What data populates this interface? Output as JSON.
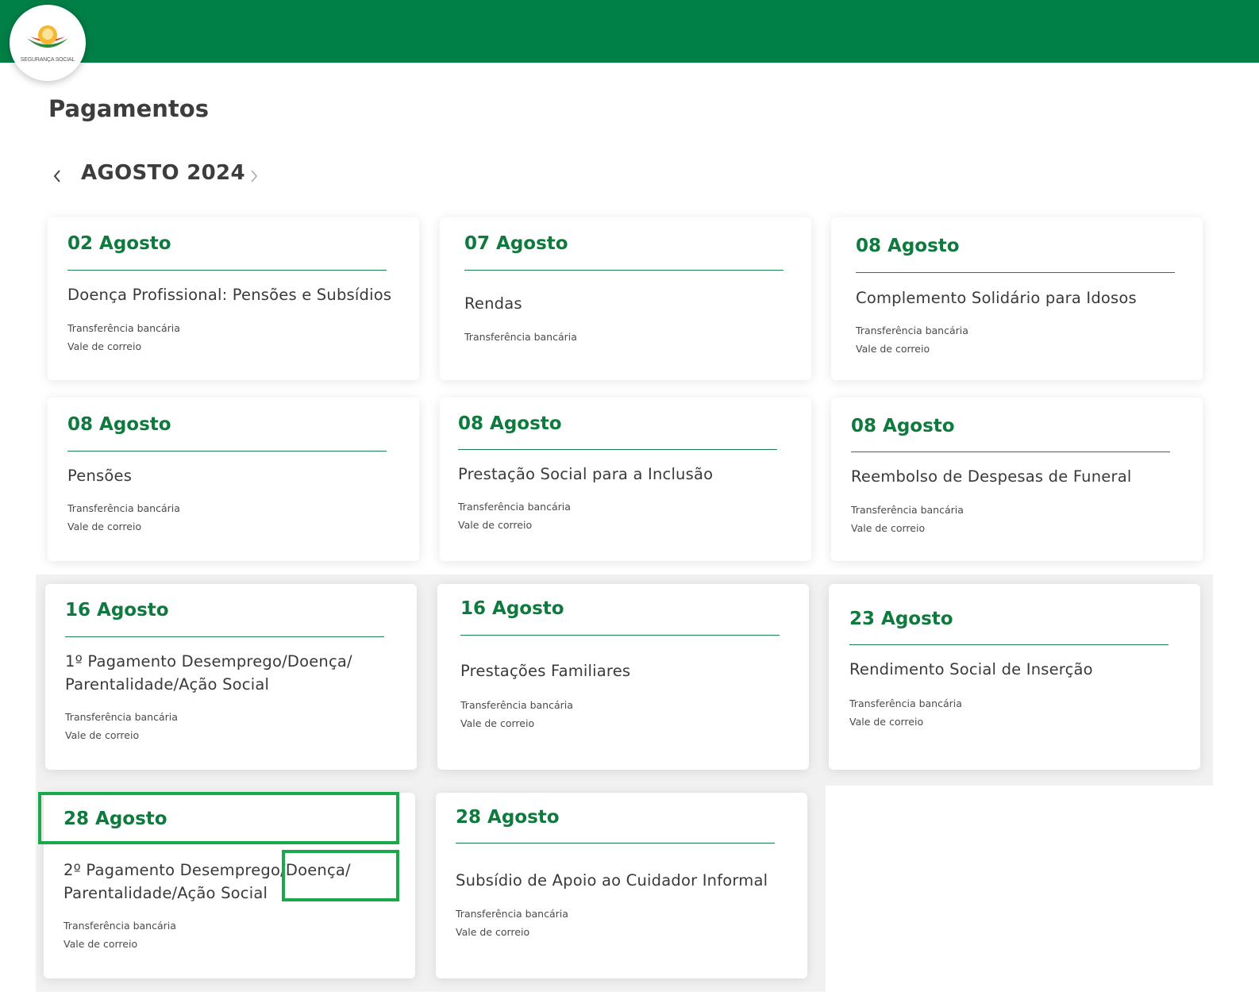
{
  "header": {
    "logo_text": "SEGURANÇA SOCIAL",
    "brand_color": "#007f46",
    "logo_icon": "seguranca-social-logo-icon"
  },
  "page": {
    "title": "Pagamentos"
  },
  "month_nav": {
    "label": "AGOSTO 2024",
    "prev_icon": "chevron-left-icon",
    "next_icon": "chevron-right-icon"
  },
  "accent_color": "#0f7a3e",
  "highlight_color": "#1aa84c",
  "cards": [
    {
      "date": "02 Agosto",
      "title": "Doença Profissional: Pensões e Subsídios",
      "methods": [
        "Transferência bancária",
        "Vale de correio"
      ]
    },
    {
      "date": "07 Agosto",
      "title": "Rendas",
      "methods": [
        "Transferência bancária"
      ]
    },
    {
      "date": "08 Agosto",
      "title": "Complemento Solidário para Idosos",
      "methods": [
        "Transferência bancária",
        "Vale de correio"
      ]
    },
    {
      "date": "08 Agosto",
      "title": "Pensões",
      "methods": [
        "Transferência bancária",
        "Vale de correio"
      ]
    },
    {
      "date": "08 Agosto",
      "title": "Prestação Social para a Inclusão",
      "methods": [
        "Transferência bancária",
        "Vale de correio"
      ]
    },
    {
      "date": "08 Agosto",
      "title": "Reembolso de Despesas de Funeral",
      "methods": [
        "Transferência bancária",
        "Vale de correio"
      ]
    },
    {
      "date": "16 Agosto",
      "title": "1º Pagamento Desemprego/Doença/ Parentalidade/Ação Social",
      "methods": [
        "Transferência bancária",
        "Vale de correio"
      ]
    },
    {
      "date": "16 Agosto",
      "title": "Prestações Familiares",
      "methods": [
        "Transferência bancária",
        "Vale de correio"
      ]
    },
    {
      "date": "23 Agosto",
      "title": "Rendimento Social de Inserção",
      "methods": [
        "Transferência bancária",
        "Vale de correio"
      ]
    },
    {
      "date": "28 Agosto",
      "title": "2º Pagamento Desemprego/Doença/ Parentalidade/Ação Social",
      "methods": [
        "Transferência bancária",
        "Vale de correio"
      ]
    },
    {
      "date": "28 Agosto",
      "title": "Subsídio de Apoio ao Cuidador Informal",
      "methods": [
        "Transferência bancária",
        "Vale de correio"
      ]
    }
  ]
}
